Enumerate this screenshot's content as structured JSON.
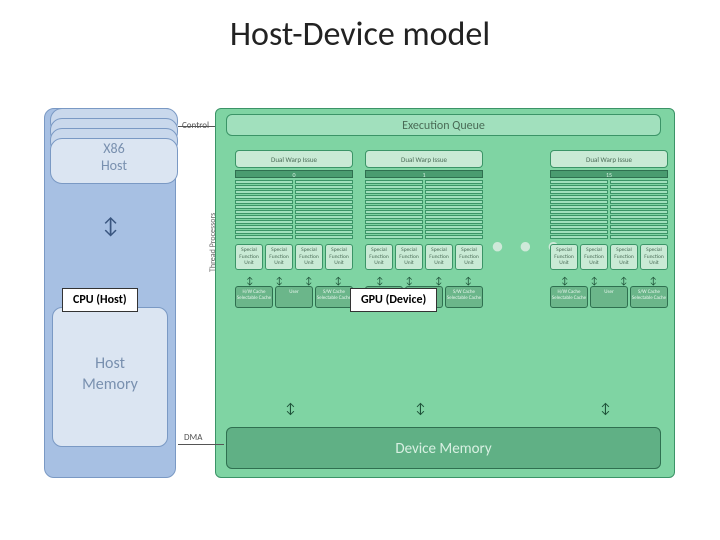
{
  "title": "Host-Device model",
  "host": {
    "cpu_line1": "X86",
    "cpu_line2": "Host",
    "memory_line1": "Host",
    "memory_line2": "Memory",
    "callout": "CPU (Host)"
  },
  "links": {
    "control": "Control",
    "dma": "DMA",
    "thread_processors": "Thread Processors"
  },
  "device": {
    "exec_queue": "Execution Queue",
    "callout": "GPU (Device)",
    "ellipsis": "• • •",
    "device_memory": "Device Memory",
    "sm": {
      "warp": "Dual Warp Issue",
      "indices": [
        "0",
        "1",
        "15"
      ],
      "func_unit": "Special Function Unit",
      "cache_hw": "H/W Cache Selectable Cache",
      "cache_user": "User",
      "cache_sw": "S/W Cache Selectable Cache"
    }
  }
}
